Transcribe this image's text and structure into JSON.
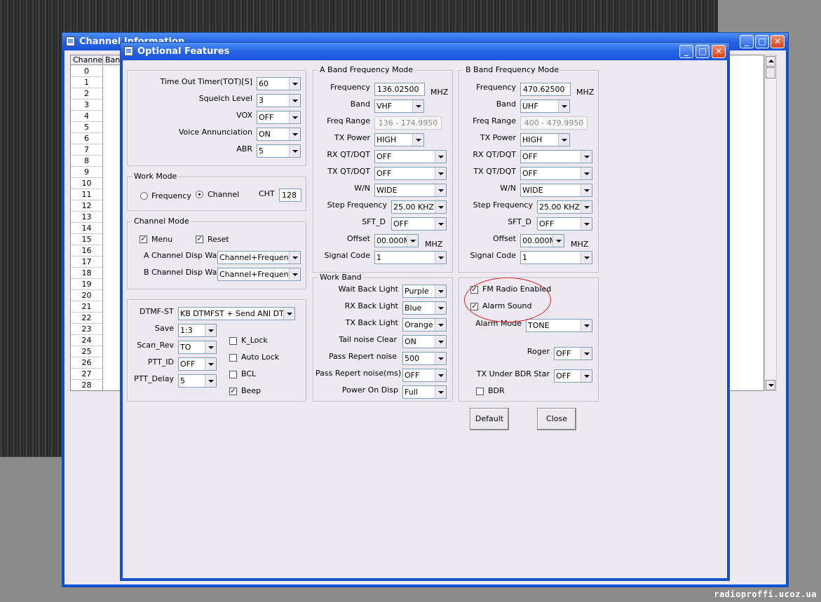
{
  "background": {
    "watermark": "radioproffi.ucoz.ua"
  },
  "channel_window": {
    "title": "Channel Information",
    "col_channel": "Channel",
    "col_band": "Band",
    "rows": [
      "0",
      "1",
      "2",
      "3",
      "4",
      "5",
      "6",
      "7",
      "8",
      "9",
      "10",
      "11",
      "12",
      "13",
      "14",
      "15",
      "16",
      "17",
      "18",
      "19",
      "20",
      "21",
      "22",
      "23",
      "24",
      "25",
      "26",
      "27",
      "28"
    ],
    "btn_min": "_",
    "btn_max": "□",
    "btn_close": "✕"
  },
  "dialog": {
    "title": "Optional Features",
    "btn_min": "_",
    "btn_max": "□",
    "btn_close": "✕",
    "general": {
      "tot_label": "Time Out Timer(TOT)[S]",
      "tot_value": "60",
      "squelch_label": "Squelch Level",
      "squelch_value": "3",
      "vox_label": "VOX",
      "vox_value": "OFF",
      "voice_label": "Voice Annunciation",
      "voice_value": "ON",
      "abr_label": "ABR",
      "abr_value": "5"
    },
    "work_mode": {
      "title": "Work Mode",
      "frequency": "Frequency",
      "channel": "Channel",
      "cht_label": "CHT",
      "cht_value": "128"
    },
    "channel_mode": {
      "title": "Channel Mode",
      "menu": "Menu",
      "reset": "Reset",
      "a_disp_label": "A Channel Disp Way",
      "a_disp_value": "Channel+Frequency",
      "b_disp_label": "B Channel Disp Way",
      "b_disp_value": "Channel+Frequency"
    },
    "dtmf": {
      "dtmf_label": "DTMF-ST",
      "dtmf_value": "KB DTMFST + Send ANI DTMF",
      "save_label": "Save",
      "save_value": "1:3",
      "scanrev_label": "Scan_Rev",
      "scanrev_value": "TO",
      "pttid_label": "PTT_ID",
      "pttid_value": "OFF",
      "pttdelay_label": "PTT_Delay",
      "pttdelay_value": "5",
      "klock": "K_Lock",
      "autolock": "Auto Lock",
      "bcl": "BCL",
      "beep": "Beep"
    },
    "a_band": {
      "title": "A Band Frequency Mode",
      "freq_label": "Frequency",
      "freq_value": "136.02500",
      "mhz": "MHZ",
      "band_label": "Band",
      "band_value": "VHF",
      "range_label": "Freq Range",
      "range_value": "136 - 174.9950",
      "txpower_label": "TX Power",
      "txpower_value": "HIGH",
      "rxqt_label": "RX QT/DQT",
      "rxqt_value": "OFF",
      "txqt_label": "TX QT/DQT",
      "txqt_value": "OFF",
      "wn_label": "W/N",
      "wn_value": "WIDE",
      "step_label": "Step Frequency",
      "step_value": "25.00 KHZ",
      "sftd_label": "SFT_D",
      "sftd_value": "OFF",
      "offset_label": "Offset",
      "offset_value": "00.000M",
      "offset_unit": "MHZ",
      "signal_label": "Signal Code",
      "signal_value": "1"
    },
    "b_band": {
      "title": "B Band Frequency Mode",
      "freq_label": "Frequency",
      "freq_value": "470.62500",
      "mhz": "MHZ",
      "band_label": "Band",
      "band_value": "UHF",
      "range_label": "Freq Range",
      "range_value": "400 - 479.9950",
      "txpower_label": "TX Power",
      "txpower_value": "HIGH",
      "rxqt_label": "RX QT/DQT",
      "rxqt_value": "OFF",
      "txqt_label": "TX QT/DQT",
      "txqt_value": "OFF",
      "wn_label": "W/N",
      "wn_value": "WIDE",
      "step_label": "Step Frequency",
      "step_value": "25.00 KHZ",
      "sftd_label": "SFT_D",
      "sftd_value": "OFF",
      "offset_label": "Offset",
      "offset_value": "00.000M",
      "offset_unit": "MHZ",
      "signal_label": "Signal Code",
      "signal_value": "1"
    },
    "work_band": {
      "title": "Work Band",
      "wait_label": "Wait Back Light",
      "wait_value": "Purple",
      "rx_label": "RX Back Light",
      "rx_value": "Blue",
      "tx_label": "TX Back Light",
      "tx_value": "Orange",
      "tail_label": "Tail noise Clear",
      "tail_value": "ON",
      "prn_label": "Pass Repert noise",
      "prn_value": "500",
      "prnms_label": "Pass Repert noise(ms)",
      "prnms_value": "OFF",
      "power_label": "Power On Disp",
      "power_value": "Full"
    },
    "misc": {
      "fm_radio": "FM Radio Enabled",
      "alarm_sound": "Alarm Sound",
      "alarm_mode_label": "Alarm Mode",
      "alarm_mode_value": "TONE",
      "roger_label": "Roger",
      "roger_value": "OFF",
      "txbdr_label": "TX Under BDR Star",
      "txbdr_value": "OFF",
      "bdr": "BDR"
    },
    "default_button": "Default",
    "close_button": "Close",
    "check_mark": "✓",
    "highlight_color": "#dd2222"
  }
}
